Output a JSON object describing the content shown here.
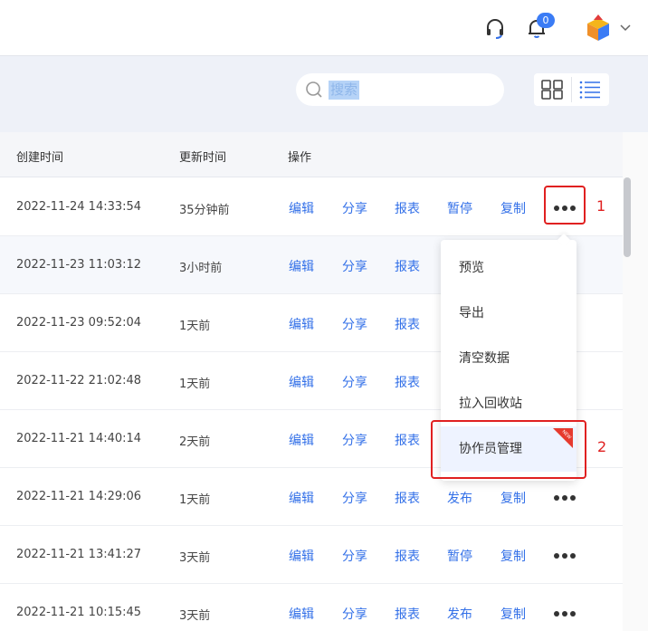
{
  "header": {
    "notification_count": "0"
  },
  "toolbar": {
    "search_highlight": "搜索"
  },
  "table": {
    "columns": [
      "创建时间",
      "更新时间",
      "操作"
    ],
    "rows": [
      {
        "created": "2022-11-24 14:33:54",
        "updated": "35分钟前",
        "actions": [
          "编辑",
          "分享",
          "报表",
          "暂停",
          "复制"
        ]
      },
      {
        "created": "2022-11-23 11:03:12",
        "updated": "3小时前",
        "actions": [
          "编辑",
          "分享",
          "报表"
        ]
      },
      {
        "created": "2022-11-23 09:52:04",
        "updated": "1天前",
        "actions": [
          "编辑",
          "分享",
          "报表"
        ]
      },
      {
        "created": "2022-11-22 21:02:48",
        "updated": "1天前",
        "actions": [
          "编辑",
          "分享",
          "报表"
        ]
      },
      {
        "created": "2022-11-21 14:40:14",
        "updated": "2天前",
        "actions": [
          "编辑",
          "分享",
          "报表"
        ]
      },
      {
        "created": "2022-11-21 14:29:06",
        "updated": "1天前",
        "actions": [
          "编辑",
          "分享",
          "报表",
          "发布",
          "复制"
        ]
      },
      {
        "created": "2022-11-21 13:41:27",
        "updated": "3天前",
        "actions": [
          "编辑",
          "分享",
          "报表",
          "暂停",
          "复制"
        ]
      },
      {
        "created": "2022-11-21 10:15:45",
        "updated": "3天前",
        "actions": [
          "编辑",
          "分享",
          "报表",
          "发布",
          "复制"
        ]
      }
    ]
  },
  "dropdown": {
    "items": [
      "预览",
      "导出",
      "清空数据",
      "拉入回收站",
      "协作员管理"
    ],
    "new_tag": "NEW"
  },
  "annotations": {
    "marker_1": "1",
    "marker_2": "2"
  },
  "colors": {
    "accent": "#3370e8",
    "annotation": "#e02020"
  }
}
